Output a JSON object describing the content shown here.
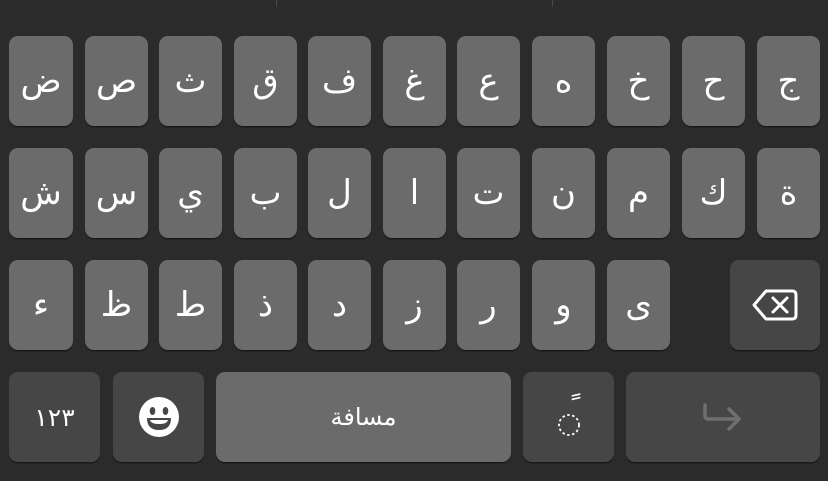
{
  "keyboard": {
    "row1": [
      "ج",
      "ح",
      "خ",
      "ه",
      "ع",
      "غ",
      "ف",
      "ق",
      "ث",
      "ص",
      "ض"
    ],
    "row2": [
      "ة",
      "ك",
      "م",
      "ن",
      "ت",
      "ا",
      "ل",
      "ب",
      "ي",
      "س",
      "ش"
    ],
    "row3": [
      "ى",
      "و",
      "ر",
      "ز",
      "د",
      "ذ",
      "ط",
      "ظ",
      "ء"
    ],
    "numbers_label": "١٢٣",
    "space_label": "مسافة",
    "diacritic_label": "ً",
    "icons": {
      "delete": "delete-left-icon",
      "emoji": "emoji-face-icon",
      "return": "return-arrow-icon"
    },
    "colors": {
      "background": "#2b2b2b",
      "key": "#6b6b6b",
      "function_key": "#464646",
      "text": "#ffffff"
    }
  }
}
